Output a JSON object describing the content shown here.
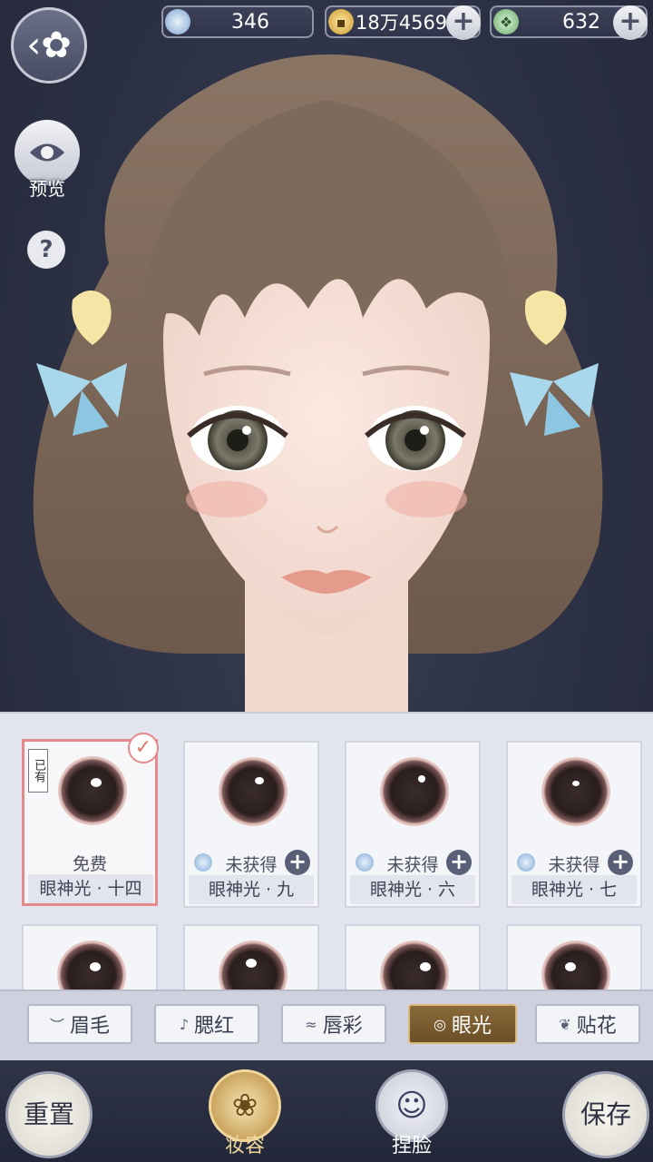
{
  "currencies": [
    {
      "icon": "jade-orb-icon",
      "value": "346",
      "has_plus": false
    },
    {
      "icon": "copper-coin-icon",
      "value": "18万4569",
      "has_plus": true
    },
    {
      "icon": "green-crest-icon",
      "value": "632",
      "has_plus": true
    }
  ],
  "side": {
    "preview_label": "预览",
    "help_label": "?"
  },
  "items": [
    {
      "status": "免费",
      "name": "眼神光 · 十四",
      "selected": true,
      "owned_badge": "已有"
    },
    {
      "status": "未获得",
      "name": "眼神光 · 九",
      "selected": false
    },
    {
      "status": "未获得",
      "name": "眼神光 · 六",
      "selected": false
    },
    {
      "status": "未获得",
      "name": "眼神光 · 七",
      "selected": false
    }
  ],
  "tabs": [
    {
      "label": "眉毛",
      "icon": "eyebrow-icon",
      "active": false
    },
    {
      "label": "腮红",
      "icon": "blush-icon",
      "active": false
    },
    {
      "label": "唇彩",
      "icon": "lips-icon",
      "active": false
    },
    {
      "label": "眼光",
      "icon": "eye-light-icon",
      "active": true
    },
    {
      "label": "贴花",
      "icon": "sticker-icon",
      "active": false
    }
  ],
  "bottom": {
    "reset_label": "重置",
    "makeup_label": "妆容",
    "face_label": "捏脸",
    "save_label": "保存"
  },
  "colors": {
    "accent": "#e48a8a",
    "active_tab": "#7a5c30",
    "bg": "#2b2f42"
  }
}
